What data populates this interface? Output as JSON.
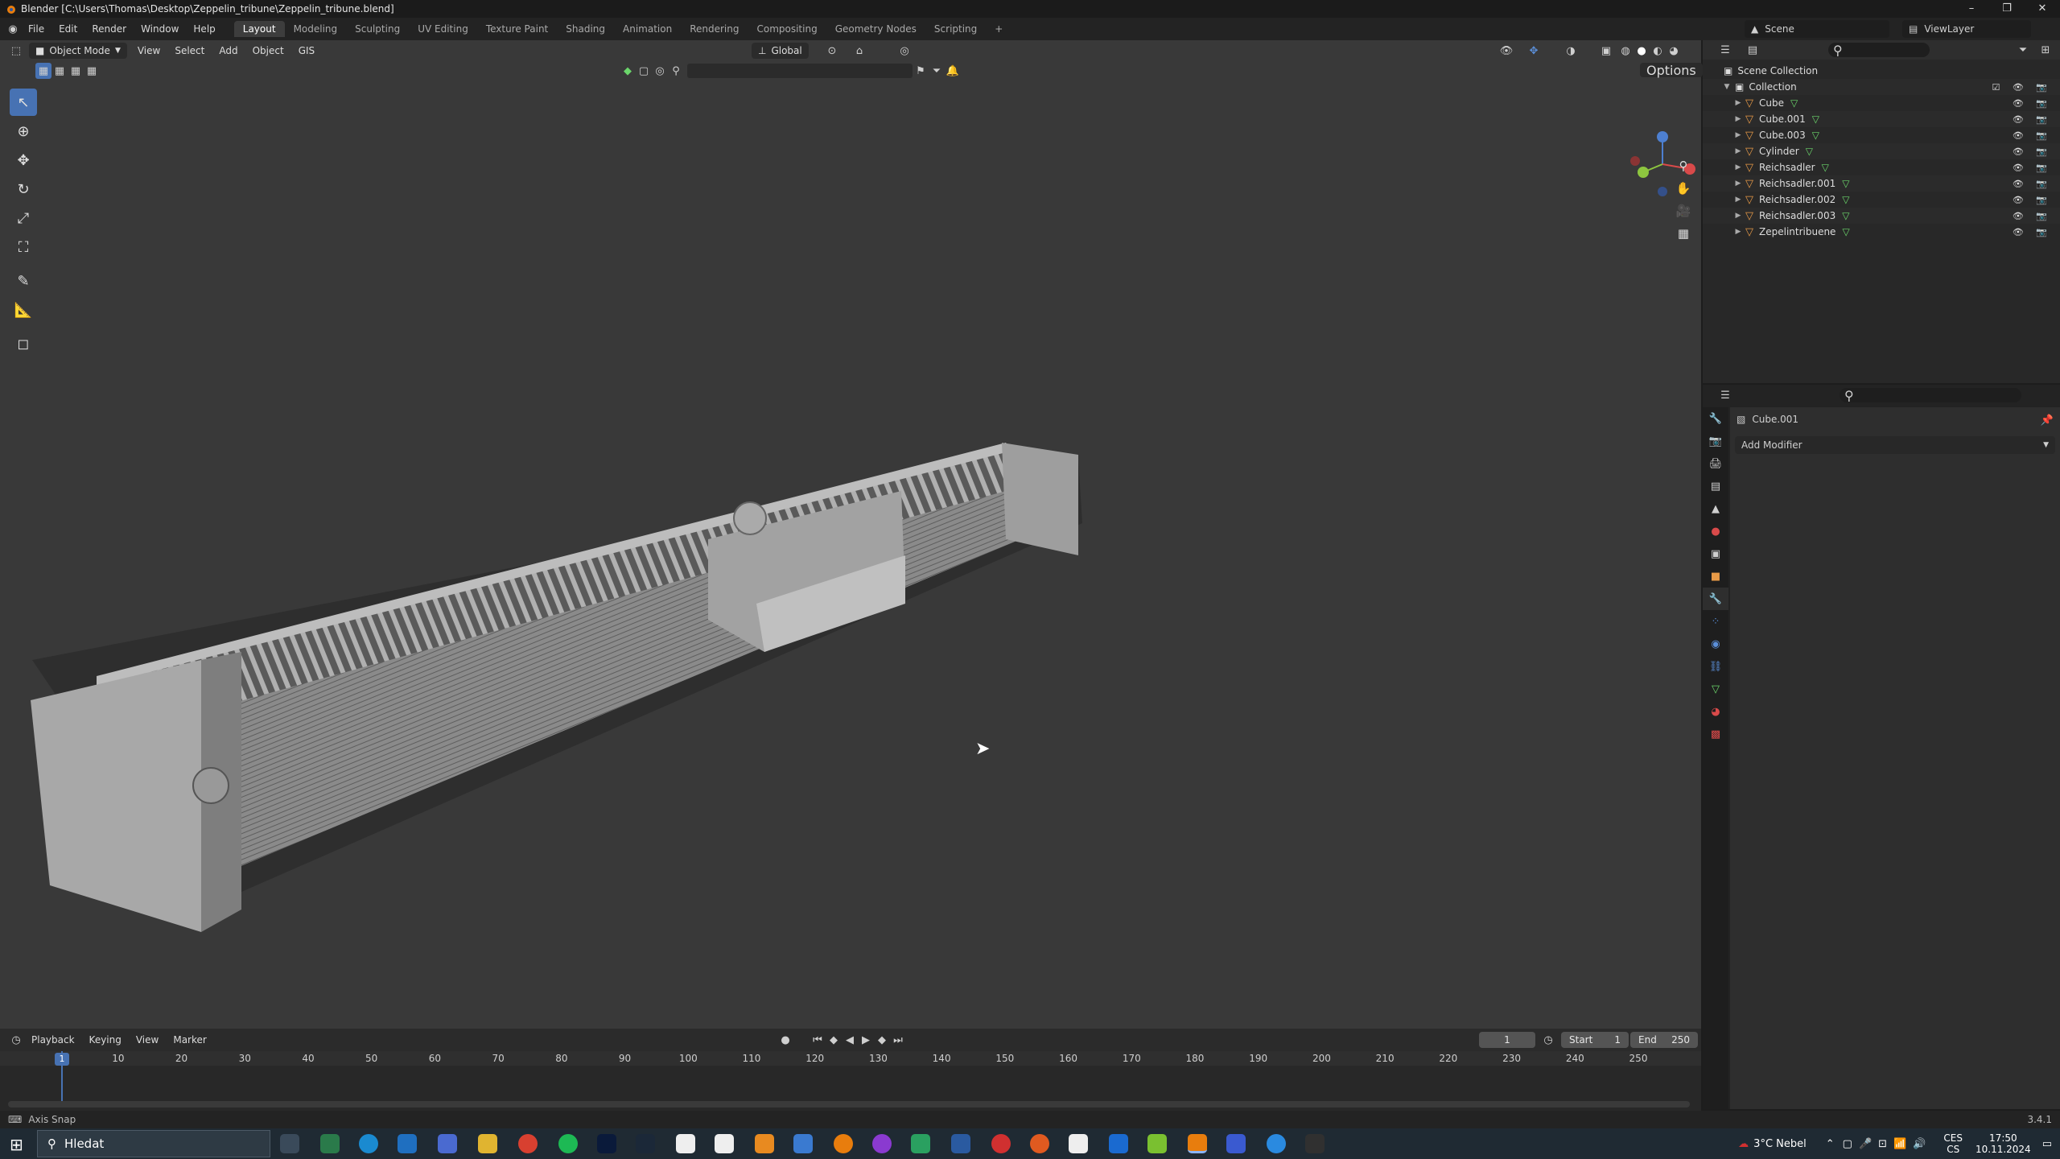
{
  "window": {
    "title": "Blender [C:\\Users\\Thomas\\Desktop\\Zeppelin_tribune\\Zeppelin_tribune.blend]"
  },
  "menubar": {
    "items": [
      "File",
      "Edit",
      "Render",
      "Window",
      "Help"
    ],
    "tabs": [
      "Layout",
      "Modeling",
      "Sculpting",
      "UV Editing",
      "Texture Paint",
      "Shading",
      "Animation",
      "Rendering",
      "Compositing",
      "Geometry Nodes",
      "Scripting"
    ],
    "active_tab": "Layout",
    "scene": "Scene",
    "view_layer": "ViewLayer"
  },
  "viewport": {
    "mode": "Object Mode",
    "menus": [
      "View",
      "Select",
      "Add",
      "Object",
      "GIS"
    ],
    "orientation": "Global",
    "options_label": "Options"
  },
  "timeline": {
    "menus": [
      "Playback",
      "Keying",
      "View",
      "Marker"
    ],
    "current_frame": "1",
    "start_label": "Start",
    "start": "1",
    "end_label": "End",
    "end": "250",
    "ticks": [
      "1",
      "10",
      "20",
      "30",
      "40",
      "50",
      "60",
      "70",
      "80",
      "90",
      "100",
      "110",
      "120",
      "130",
      "140",
      "150",
      "160",
      "170",
      "180",
      "190",
      "200",
      "210",
      "220",
      "230",
      "240",
      "250"
    ]
  },
  "status": {
    "left": "Axis Snap",
    "version": "3.4.1"
  },
  "outliner": {
    "scene_collection": "Scene Collection",
    "collection": "Collection",
    "objects": [
      "Cube",
      "Cube.001",
      "Cube.003",
      "Cylinder",
      "Reichsadler",
      "Reichsadler.001",
      "Reichsadler.002",
      "Reichsadler.003",
      "Zepelintribuene"
    ]
  },
  "properties": {
    "object_name": "Cube.001",
    "add_modifier": "Add Modifier"
  },
  "taskbar": {
    "search_placeholder": "Hledat",
    "weather": "3°C  Nebel",
    "lang_top": "CES",
    "lang_bottom": "CS",
    "time": "17:50",
    "date": "10.11.2024"
  },
  "colors": {
    "accent": "#4772b3",
    "object": "#e89a47",
    "mesh": "#6bd66b"
  }
}
